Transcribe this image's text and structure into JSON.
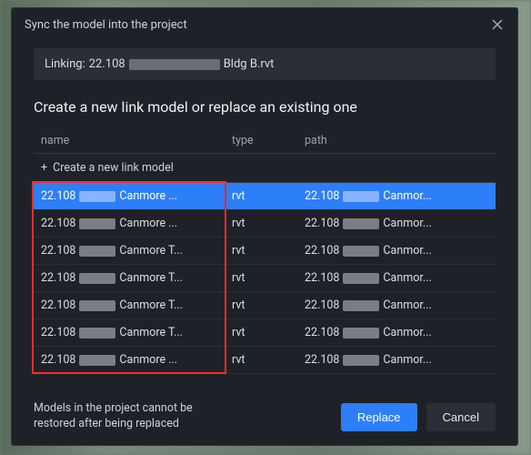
{
  "dialog": {
    "title": "Sync the model into the project",
    "linking_label": "Linking:",
    "linking_prefix": "22.108",
    "linking_suffix": "Bldg B.rvt",
    "section_title": "Create a new link model or replace an existing one",
    "create_row_label": "Create a new link model",
    "columns": {
      "name": "name",
      "type": "type",
      "path": "path"
    },
    "rows": [
      {
        "name_a": "22.108",
        "name_b": "Canmore ...",
        "type": "rvt",
        "path_a": "22.108",
        "path_b": "Canmor...",
        "selected": true
      },
      {
        "name_a": "22.108",
        "name_b": "Canmore ...",
        "type": "rvt",
        "path_a": "22.108",
        "path_b": "Canmor...",
        "selected": false
      },
      {
        "name_a": "22.108",
        "name_b": "Canmore T...",
        "type": "rvt",
        "path_a": "22.108",
        "path_b": "Canmor...",
        "selected": false
      },
      {
        "name_a": "22.108",
        "name_b": "Canmore T...",
        "type": "rvt",
        "path_a": "22.108",
        "path_b": "Canmor...",
        "selected": false
      },
      {
        "name_a": "22.108",
        "name_b": "Canmore T...",
        "type": "rvt",
        "path_a": "22.108",
        "path_b": "Canmor...",
        "selected": false
      },
      {
        "name_a": "22.108",
        "name_b": "Canmore T...",
        "type": "rvt",
        "path_a": "22.108",
        "path_b": "Canmor...",
        "selected": false
      },
      {
        "name_a": "22.108",
        "name_b": "Canmore ...",
        "type": "rvt",
        "path_a": "22.108",
        "path_b": "Canmor...",
        "selected": false
      }
    ],
    "warning": "Models in the project cannot be restored after being replaced",
    "buttons": {
      "replace": "Replace",
      "cancel": "Cancel"
    }
  }
}
